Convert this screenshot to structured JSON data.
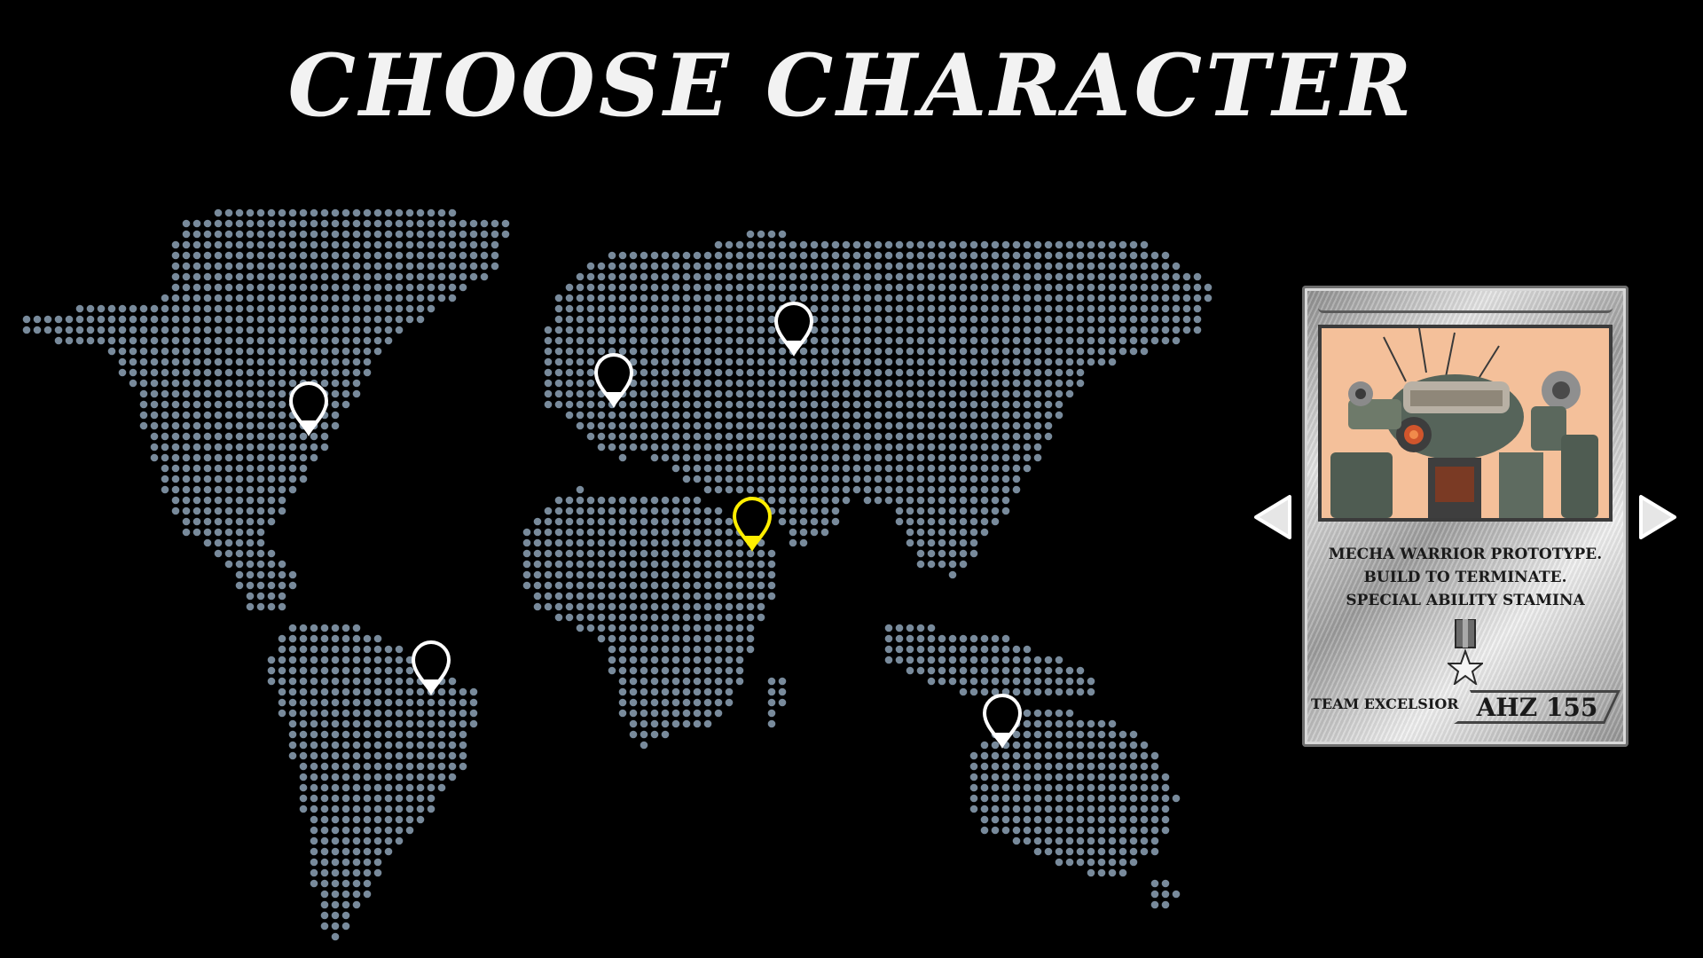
{
  "screen": {
    "title": "CHOOSE CHARACTER"
  },
  "map": {
    "dot_color": "#788a9b",
    "pin_color": "#ffffff",
    "selected_pin_color": "#ffee00",
    "pins": [
      {
        "name": "north-america",
        "selected": false
      },
      {
        "name": "south-america",
        "selected": false
      },
      {
        "name": "europe",
        "selected": false
      },
      {
        "name": "russia",
        "selected": false
      },
      {
        "name": "africa",
        "selected": true
      },
      {
        "name": "australia",
        "selected": false
      }
    ]
  },
  "card": {
    "description_line1": "MECHA WARRIOR PROTOTYPE.",
    "description_line2": "BUILD TO TERMINATE.",
    "description_line3": "SPECIAL ABILITY  STAMINA",
    "team": "TEAM EXCELSIOR",
    "serial": "AHZ 155",
    "portrait_icon": "mecha-robot-portrait",
    "medal_icon": "star-medal-icon"
  },
  "navigation": {
    "prev_icon": "arrow-left-icon",
    "next_icon": "arrow-right-icon"
  }
}
